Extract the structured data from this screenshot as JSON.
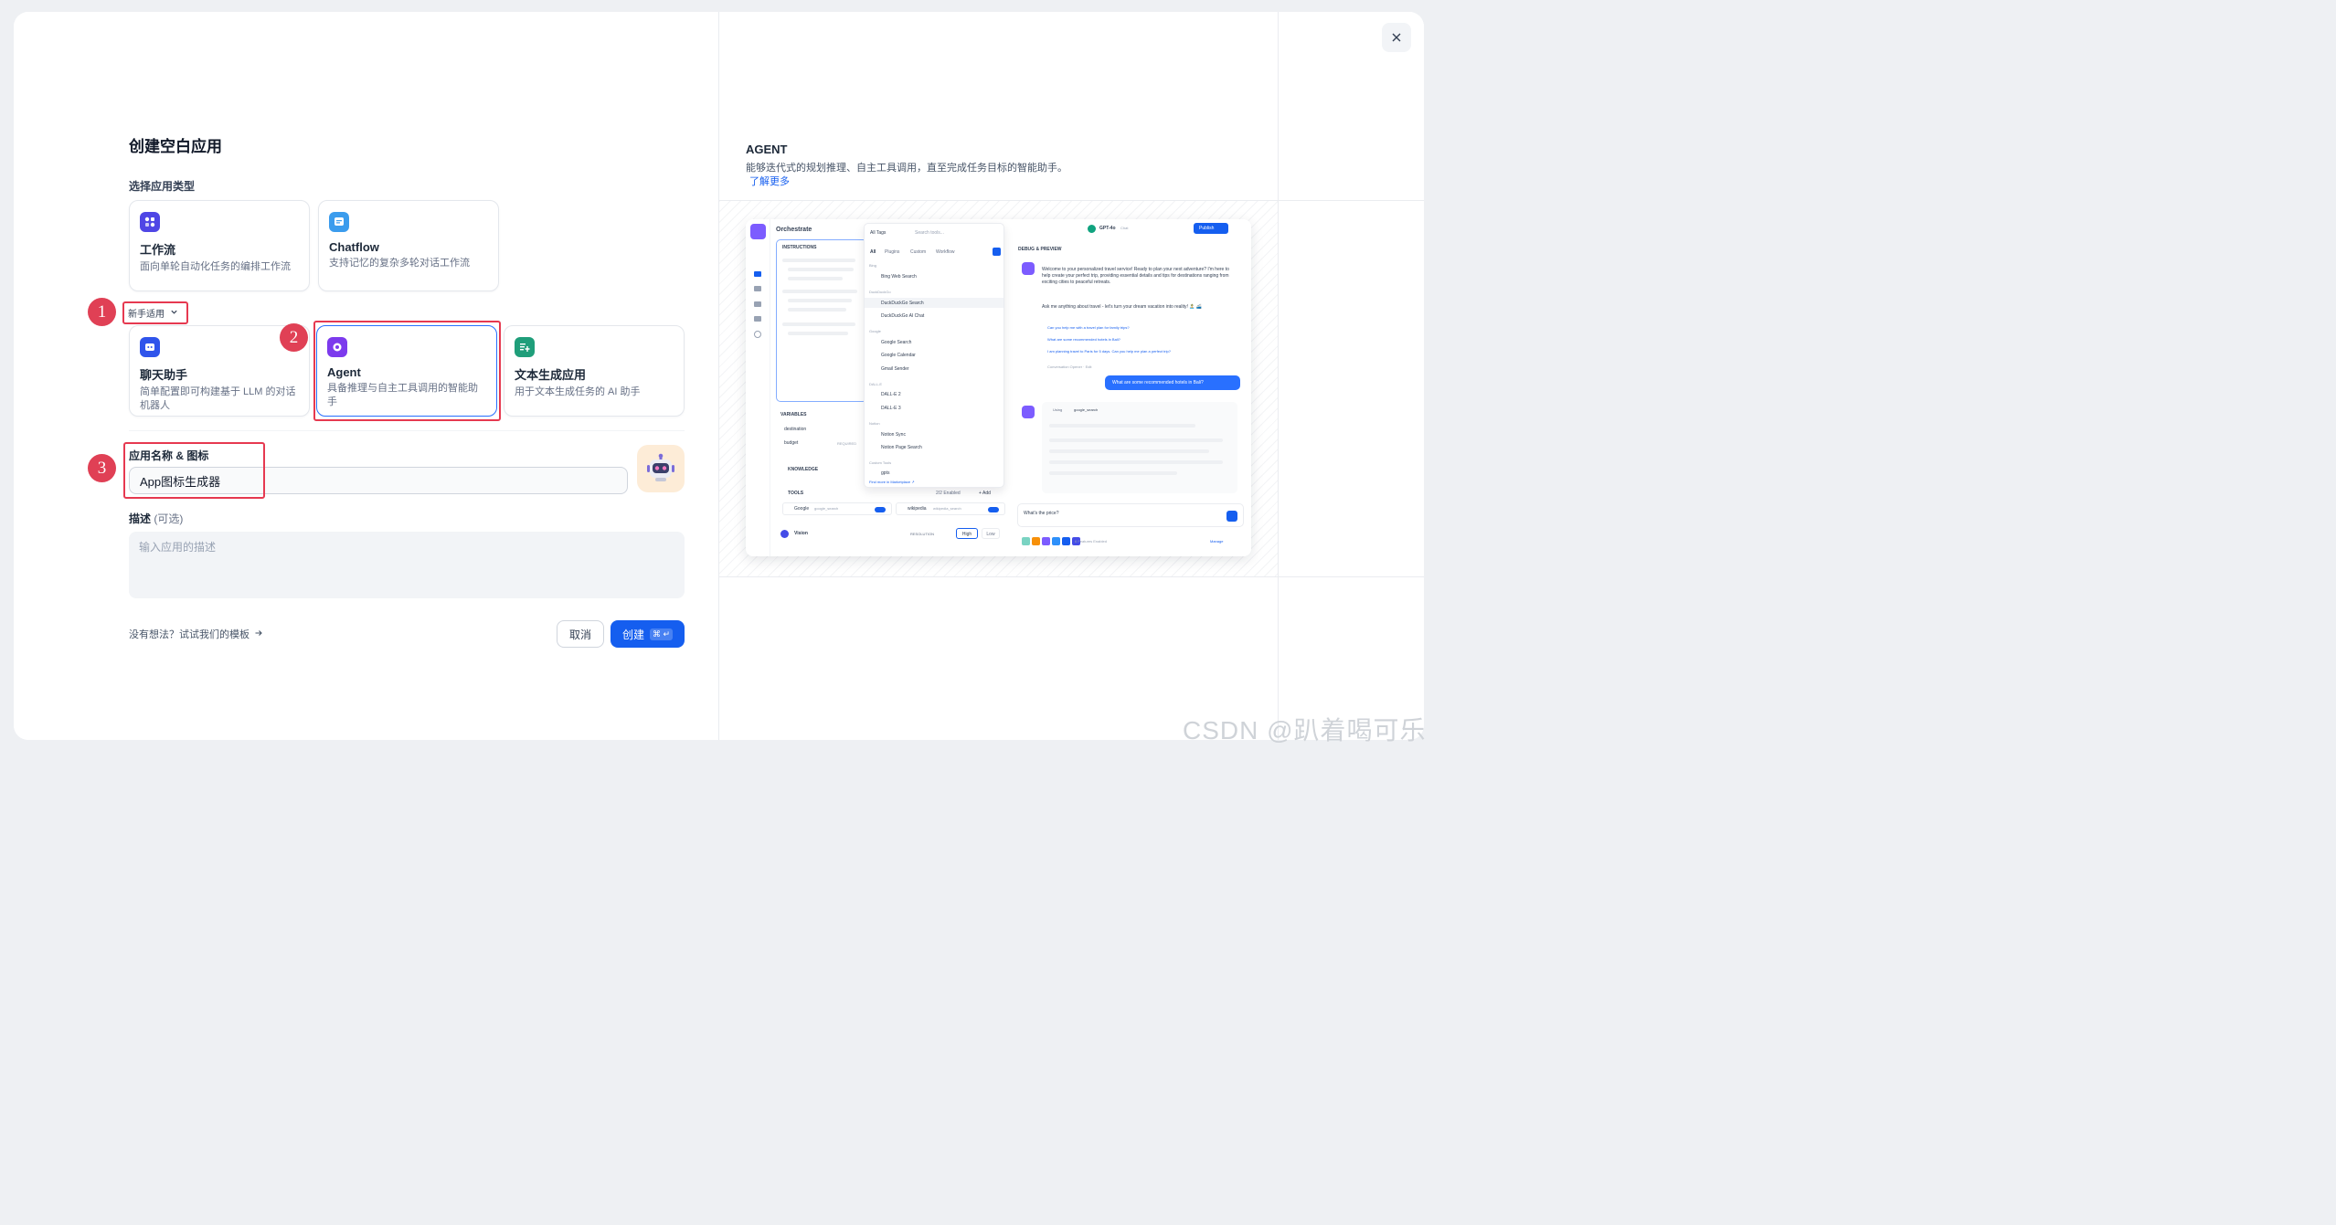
{
  "dialog": {
    "title": "创建空白应用",
    "select_type_label": "选择应用类型",
    "close_icon": "close-icon"
  },
  "app_types_top": [
    {
      "name": "工作流",
      "desc": "面向单轮自动化任务的编排工作流",
      "icon": "workflow-icon",
      "color": "#4f46e5"
    },
    {
      "name": "Chatflow",
      "desc": "支持记忆的复杂多轮对话工作流",
      "icon": "chatflow-icon",
      "color": "#3b9ced"
    }
  ],
  "beginner_toggle": "新手适用",
  "app_types_bottom": [
    {
      "name": "聊天助手",
      "desc": "简单配置即可构建基于 LLM 的对话机器人",
      "icon": "chatbot-icon",
      "color": "#2f54eb"
    },
    {
      "name": "Agent",
      "desc": "具备推理与自主工具调用的智能助手",
      "icon": "agent-icon",
      "color": "#7c3aed"
    },
    {
      "name": "文本生成应用",
      "desc": "用于文本生成任务的 AI 助手",
      "icon": "text-generation-icon",
      "color": "#1f9e7a"
    }
  ],
  "annotations": [
    "1",
    "2",
    "3"
  ],
  "name_field": {
    "label": "应用名称 & 图标",
    "value": "App图标生成器",
    "avatar_icon": "robot-icon"
  },
  "description_field": {
    "label": "描述",
    "optional": "(可选)",
    "placeholder": "输入应用的描述"
  },
  "template_link": "没有想法？试试我们的模板",
  "buttons": {
    "cancel": "取消",
    "create": "创建",
    "create_shortcut": "⌘ ↵"
  },
  "preview_panel": {
    "title": "AGENT",
    "desc": "能够迭代式的规划推理、自主工具调用，直至完成任务目标的智能助手。",
    "learn_more": "了解更多"
  },
  "preview_mock": {
    "orchestrate": "Orchestrate",
    "instructions": "INSTRUCTIONS",
    "all_tags": "All Tags",
    "search_tools": "Search tools...",
    "tabs": [
      "All",
      "Plugins",
      "Custom",
      "Workflow"
    ],
    "model": "GPT-4o",
    "model_tag": "Chat",
    "publish": "Publish",
    "debug": "DEBUG & PREVIEW",
    "tool_groups": [
      {
        "group": "Bing",
        "items": [
          "Bing Web Search"
        ]
      },
      {
        "group": "DuckDuckGo",
        "items": [
          "DuckDuckGo Search",
          "DuckDuckGo AI Chat"
        ]
      },
      {
        "group": "Google",
        "items": [
          "Google Search",
          "Google Calendar",
          "Gmail Sender"
        ]
      },
      {
        "group": "DALL-E",
        "items": [
          "DALL-E 2",
          "DALL-E 3"
        ]
      },
      {
        "group": "Notion",
        "items": [
          "Notion Sync",
          "Notion Page Search"
        ]
      },
      {
        "group": "Custom Tools",
        "items": [
          "gpts"
        ]
      }
    ],
    "marketplace": "Find more in Marketplace ↗",
    "variables": "VARIABLES",
    "var_items": [
      "destination",
      "budget"
    ],
    "required": "REQUIRED",
    "knowledge": "KNOWLEDGE",
    "tools": "TOOLS",
    "tools_enabled": "2/2 Enabled",
    "add": "+ Add",
    "tool_rows": [
      {
        "name": "Google",
        "tag": "google_search"
      },
      {
        "name": "wikipedia",
        "tag": "wikipedia_search"
      }
    ],
    "vision": "Vision",
    "resolution": "RESOLUTION",
    "res_options": [
      "High",
      "Low"
    ],
    "welcome": "Welcome to your personalized travel service! Ready to plan your next adventure? I'm here to help create your perfect trip, providing essential details and tips for destinations ranging from exciting cities to peaceful retreats.",
    "welcome2": "Ask me anything about travel - let's turn your dream vacation into reality! 🏝️ 🚄",
    "suggestions": [
      "Can you help me with a travel plan for family trips?",
      "What are some recommended hotels in Bali?",
      "I am planning travel to Paris for 5 days. Can you help me plan a perfect trip?"
    ],
    "opener": "Conversation Opener · Edit",
    "user_msg": "What are some recommended hotels in Bali?",
    "using": "Using",
    "using_tool": "google_search",
    "input": "What's the price?",
    "features": "6 Features Enabled",
    "manage": "Manage"
  },
  "watermark": "CSDN @趴着喝可乐"
}
